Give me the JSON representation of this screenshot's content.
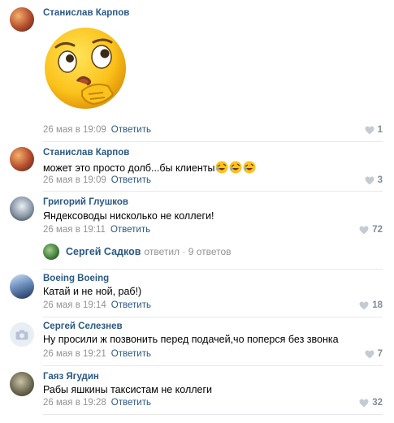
{
  "comments": [
    {
      "author": "Станислав Карпов",
      "text": "",
      "sticker": "thinking-face-sticker",
      "date": "26 мая в 19:09",
      "reply": "Ответить",
      "likes": "1"
    },
    {
      "author": "Станислав Карпов",
      "text": "может это просто долб...бы клиенты",
      "emojis": [
        "rolling-on-floor-laughing",
        "rolling-on-floor-laughing",
        "rolling-on-floor-laughing"
      ],
      "date": "26 мая в 19:09",
      "reply": "Ответить",
      "likes": "3"
    },
    {
      "author": "Григорий Глушков",
      "text": "Яндексоводы нисколько не коллеги!",
      "date": "26 мая в 19:11",
      "reply": "Ответить",
      "likes": "72",
      "thread": {
        "name": "Сергей Садков",
        "rest": "ответил · 9 ответов"
      }
    },
    {
      "author": "Boeing Boeing",
      "text": "Катай и не ной, раб!)",
      "date": "26 мая в 19:14",
      "reply": "Ответить",
      "likes": "18"
    },
    {
      "author": "Сергей Селезнев",
      "text": "Ну просили ж позвонить перед подачей,чо поперся без звонка",
      "date": "26 мая в 19:21",
      "reply": "Ответить",
      "likes": "7"
    },
    {
      "author": "Гаяз Ягудин",
      "text": "Рабы яшкины таксистам не коллеги",
      "date": "26 мая в 19:28",
      "reply": "Ответить",
      "likes": "32"
    }
  ],
  "colors": {
    "link": "#2a5885",
    "meta": "#939393",
    "like": "#828a99",
    "divider": "#e7e8ec"
  }
}
